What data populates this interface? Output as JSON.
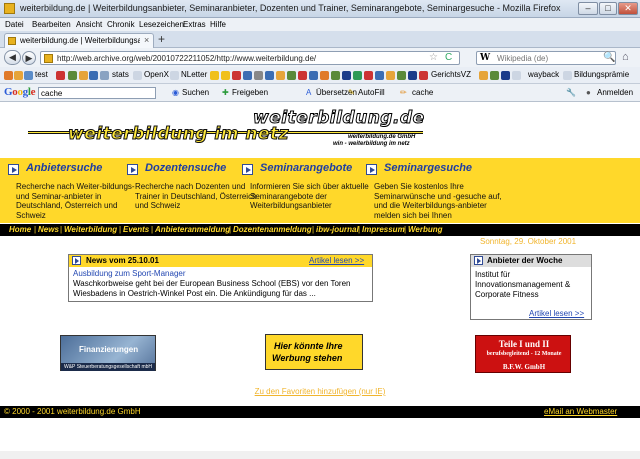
{
  "window": {
    "title": "weiterbildung.de | Weiterbildungsanbieter, Seminaranbieter, Dozenten und Trainer, Seminarangebote, Seminargesuche - Mozilla Firefox",
    "min": "–",
    "max": "□",
    "close": "✕"
  },
  "menu": [
    "Datei",
    "Bearbeiten",
    "Ansicht",
    "Chronik",
    "Lesezeichen",
    "Extras",
    "Hilfe"
  ],
  "tab": {
    "label": "weiterbildung.de | Weiterbildungsanbieter, S...",
    "close": "×",
    "new": "+"
  },
  "nav": {
    "back": "◀",
    "forward": "▶",
    "url": "http://web.archive.org/web/20010722211052/http://www.weiterbildung.de/",
    "star": "☆",
    "reload": "C",
    "search_engine": "W",
    "search_placeholder": "Wikipedia (de)",
    "search_go": "🔍",
    "home": "⌂"
  },
  "bookmarks": [
    "test",
    "stats",
    "OpenX",
    "NLetter",
    "GerichtsVZ",
    "wayback",
    "Bildungsprämie"
  ],
  "googlebar": {
    "logo": "Google",
    "query": "cache",
    "items": [
      "Suchen",
      "Freigeben",
      "Übersetzen",
      "AutoFill",
      "cache"
    ],
    "signin": "Anmelden"
  },
  "site": {
    "logo_top": "weiterbildung.de",
    "logo_bottom": "weiterbildung im netz",
    "logo_sub1": "weiterbildung.de GmbH",
    "logo_sub2": "win - weiterbildung im netz"
  },
  "sections": [
    {
      "title": "Anbietersuche",
      "text": "Recherche nach Weiter-bildungs- und Seminar-anbieter in Deutschland, Österreich und Schweiz"
    },
    {
      "title": "Dozentensuche",
      "text": "Recherche nach Dozenten und Trainer in Deutschland, Österreich und Schweiz"
    },
    {
      "title": "Seminarangebote",
      "text": "Informieren Sie sich über aktuelle Seminarangebote der Weiterbildungsanbieter"
    },
    {
      "title": "Seminargesuche",
      "text": "Geben Sie kostenlos Ihre Seminarwünsche und -gesuche auf, und die Weiterbildungs-anbieter melden sich bei Ihnen"
    }
  ],
  "navlinks": [
    "Home",
    "News",
    "Weiterbildung",
    "Events",
    "Anbieteranmeldung",
    "Dozentenanmeldung",
    "ibw-journal",
    "Impressum",
    "Werbung"
  ],
  "date": "Sonntag, 29. Oktober 2001",
  "news": {
    "title": "News vom 25.10.01",
    "more": "Artikel lesen >>",
    "link": "Ausbildung zum Sport-Manager",
    "body": "Waschkorbweise geht bei der European Business School (EBS) vor den Toren Wiesbadens in Oestrich-Winkel Post ein. Die Ankündigung für das ..."
  },
  "week": {
    "title": "Anbieter der Woche",
    "body": "Institut für Innovationsmanagement & Corporate Fitness",
    "more": "Artikel lesen >>"
  },
  "banners": {
    "b1_text": "Finanzierungen",
    "b1_foot": "W&P Steuerberatungsgesellschaft mbH",
    "b2_l1": "Hier könnte Ihre",
    "b2_l2": "Werbung stehen",
    "b3_l1": "Teile I und II",
    "b3_l2": "berufsbegleitend - 12 Monate",
    "b3_l3": "B.F.W. GmbH"
  },
  "favorites": "Zu den Favoriten hinzufügen (nur IE)",
  "footer": {
    "copy": "© 2000 - 2001 weiterbildung.de GmbH",
    "mail": "eMail an Webmaster"
  },
  "colors": {
    "brand_yellow": "#ffd82a",
    "heading_blue": "#1f3ea2",
    "link_blue": "#2247b2",
    "date_orange": "#f1b52e"
  }
}
